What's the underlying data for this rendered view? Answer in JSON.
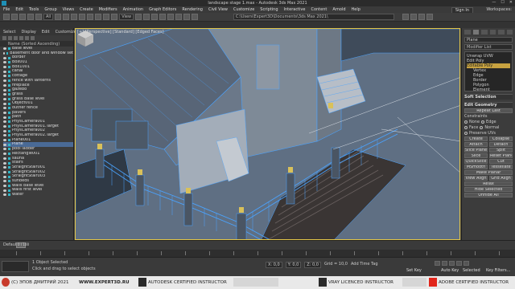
{
  "window": {
    "title": "landscape stage 1.max - Autodesk 3ds Max 2021"
  },
  "menu": {
    "items": [
      "File",
      "Edit",
      "Tools",
      "Group",
      "Views",
      "Create",
      "Modifiers",
      "Animation",
      "Graph Editors",
      "Rendering",
      "Civil View",
      "Customize",
      "Scripting",
      "Interactive",
      "Content",
      "Arnold",
      "Help"
    ],
    "signin": "Sign In",
    "workspace": "Workspaces:",
    "path": "C:\\Users\\Expert3D\\Documents\\3ds Max 2021\\"
  },
  "scene_explorer": {
    "tabs": [
      "Select",
      "Display",
      "Edit",
      "Customize"
    ],
    "header": "Name (Sorted Ascending)",
    "items": [
      {
        "name": "base level",
        "selected": false
      },
      {
        "name": "basement door and window set",
        "selected": false
      },
      {
        "name": "border",
        "selected": false
      },
      {
        "name": "Box001",
        "selected": false
      },
      {
        "name": "Box1001",
        "selected": false
      },
      {
        "name": "canal",
        "selected": false
      },
      {
        "name": "cottage",
        "selected": false
      },
      {
        "name": "fence with lanterns",
        "selected": false
      },
      {
        "name": "fireplace",
        "selected": false
      },
      {
        "name": "gazebo",
        "selected": false
      },
      {
        "name": "grass",
        "selected": false
      },
      {
        "name": "grass base level",
        "selected": false
      },
      {
        "name": "Object001",
        "selected": false
      },
      {
        "name": "outher fence",
        "selected": false
      },
      {
        "name": "pavers",
        "selected": false
      },
      {
        "name": "path",
        "selected": false
      },
      {
        "name": "PhysCamera001",
        "selected": false
      },
      {
        "name": "PhysCamera001.Target",
        "selected": false
      },
      {
        "name": "PhysCamera002",
        "selected": false
      },
      {
        "name": "PhysCamera002.Target",
        "selected": false
      },
      {
        "name": "Plane001",
        "selected": false
      },
      {
        "name": "Plane",
        "selected": true
      },
      {
        "name": "pool ladder",
        "selected": false
      },
      {
        "name": "Rectangle001",
        "selected": false
      },
      {
        "name": "sauna",
        "selected": false
      },
      {
        "name": "stairs",
        "selected": false
      },
      {
        "name": "StraightStair001",
        "selected": false
      },
      {
        "name": "StraightStair002",
        "selected": false
      },
      {
        "name": "StraightStair003",
        "selected": false
      },
      {
        "name": "sunbeds",
        "selected": false
      },
      {
        "name": "walls base level",
        "selected": false
      },
      {
        "name": "walls first level",
        "selected": false
      },
      {
        "name": "water",
        "selected": false
      }
    ]
  },
  "viewport": {
    "label": "[+] [Perspective] [Standard] [Edged Faces]"
  },
  "command_panel": {
    "object_name": "Plane",
    "modifier_list": "Modifier List",
    "stack": [
      {
        "label": "Unwrap UVW",
        "child": false,
        "selected": false
      },
      {
        "label": "Edit Poly",
        "child": false,
        "selected": false
      },
      {
        "label": "Editable Poly",
        "child": false,
        "selected": true
      },
      {
        "label": "Vertex",
        "child": true,
        "selected": false
      },
      {
        "label": "Edge",
        "child": true,
        "selected": false
      },
      {
        "label": "Border",
        "child": true,
        "selected": false
      },
      {
        "label": "Polygon",
        "child": true,
        "selected": false
      },
      {
        "label": "Element",
        "child": true,
        "selected": false
      }
    ],
    "soft_selection": "Soft Selection",
    "edit_geometry": "Edit Geometry",
    "repeat_last": "Repeat Last",
    "constraints": "Constraints",
    "constraint_none": "None",
    "constraint_edge": "Edge",
    "constraint_face": "Face",
    "constraint_normal": "Normal",
    "preserve_uvs": "Preserve UVs",
    "create": "Create",
    "collapse": "Collapse",
    "attach": "Attach",
    "detach": "Detach",
    "slice_plane": "Slice Plane",
    "split": "Split",
    "slice": "Slice",
    "reset_plane": "Reset Plane",
    "quickslice": "QuickSlice",
    "cut": "Cut",
    "meshsmooth": "MSmooth",
    "tessellate": "Tessellate",
    "make_planar": "Make Planar",
    "view_align": "View Align",
    "grid_align": "Grid Align",
    "relax": "Relax",
    "hide_selected": "Hide Selected",
    "unhide_all": "Unhide All"
  },
  "timeline": {
    "label": "Default",
    "frame": "0 / 100"
  },
  "status": {
    "selection": "1 Object Selected",
    "prompt": "Click and drag to select objects",
    "x": "X: 0,0",
    "y": "Y: 0,0",
    "z": "Z: 0,0",
    "grid": "Grid = 10,0",
    "add_time_tag": "Add Time Tag",
    "auto_key": "Auto Key",
    "selected": "Selected",
    "set_key": "Set Key",
    "key_filters": "Key Filters..."
  },
  "watermark": {
    "copyright": "(C) ЭПОВ ДМИТРИЙ 2021",
    "site": "WWW.EXPERT3D.RU",
    "autodesk": "AUTODESK CERTIFIED INSTRUCTOR",
    "vray": "VRAY LICENCED INSTRUCTOR",
    "adobe": "ADOBE CERTIFIED INSTRUCTOR"
  }
}
